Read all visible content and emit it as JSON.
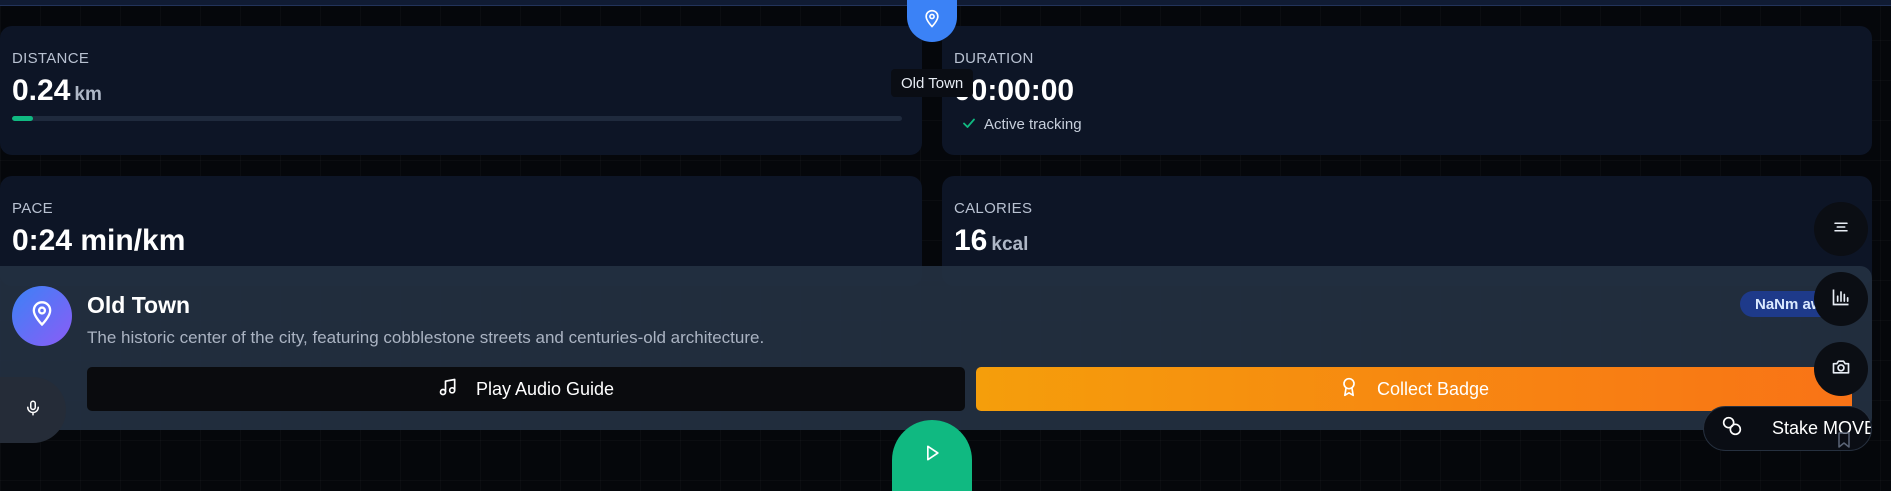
{
  "stats": {
    "distance": {
      "label": "DISTANCE",
      "value": "0.24",
      "unit": "km",
      "progress_percent": 2.4
    },
    "duration": {
      "label": "DURATION",
      "value": "00:00:00",
      "status": "Active tracking"
    },
    "pace": {
      "label": "PACE",
      "value": "0:24 min/km"
    },
    "calories": {
      "label": "CALORIES",
      "value": "16",
      "unit": "kcal"
    }
  },
  "map_marker": {
    "icon": "map-pin-icon",
    "tooltip": "Old Town"
  },
  "location": {
    "icon": "map-pin-icon",
    "title": "Old Town",
    "description": "The historic center of the city, featuring cobblestone streets and centuries-old architecture.",
    "distance_badge": "NaNm away",
    "audio_button": "Play Audio Guide",
    "badge_button": "Collect Badge"
  },
  "side_actions": [
    "list-icon",
    "bar-chart-icon",
    "camera-icon"
  ],
  "stake_button": "Stake MOVE",
  "colors": {
    "accent_blue": "#3b82f6",
    "accent_green": "#10b981",
    "accent_orange": "#f97316"
  }
}
